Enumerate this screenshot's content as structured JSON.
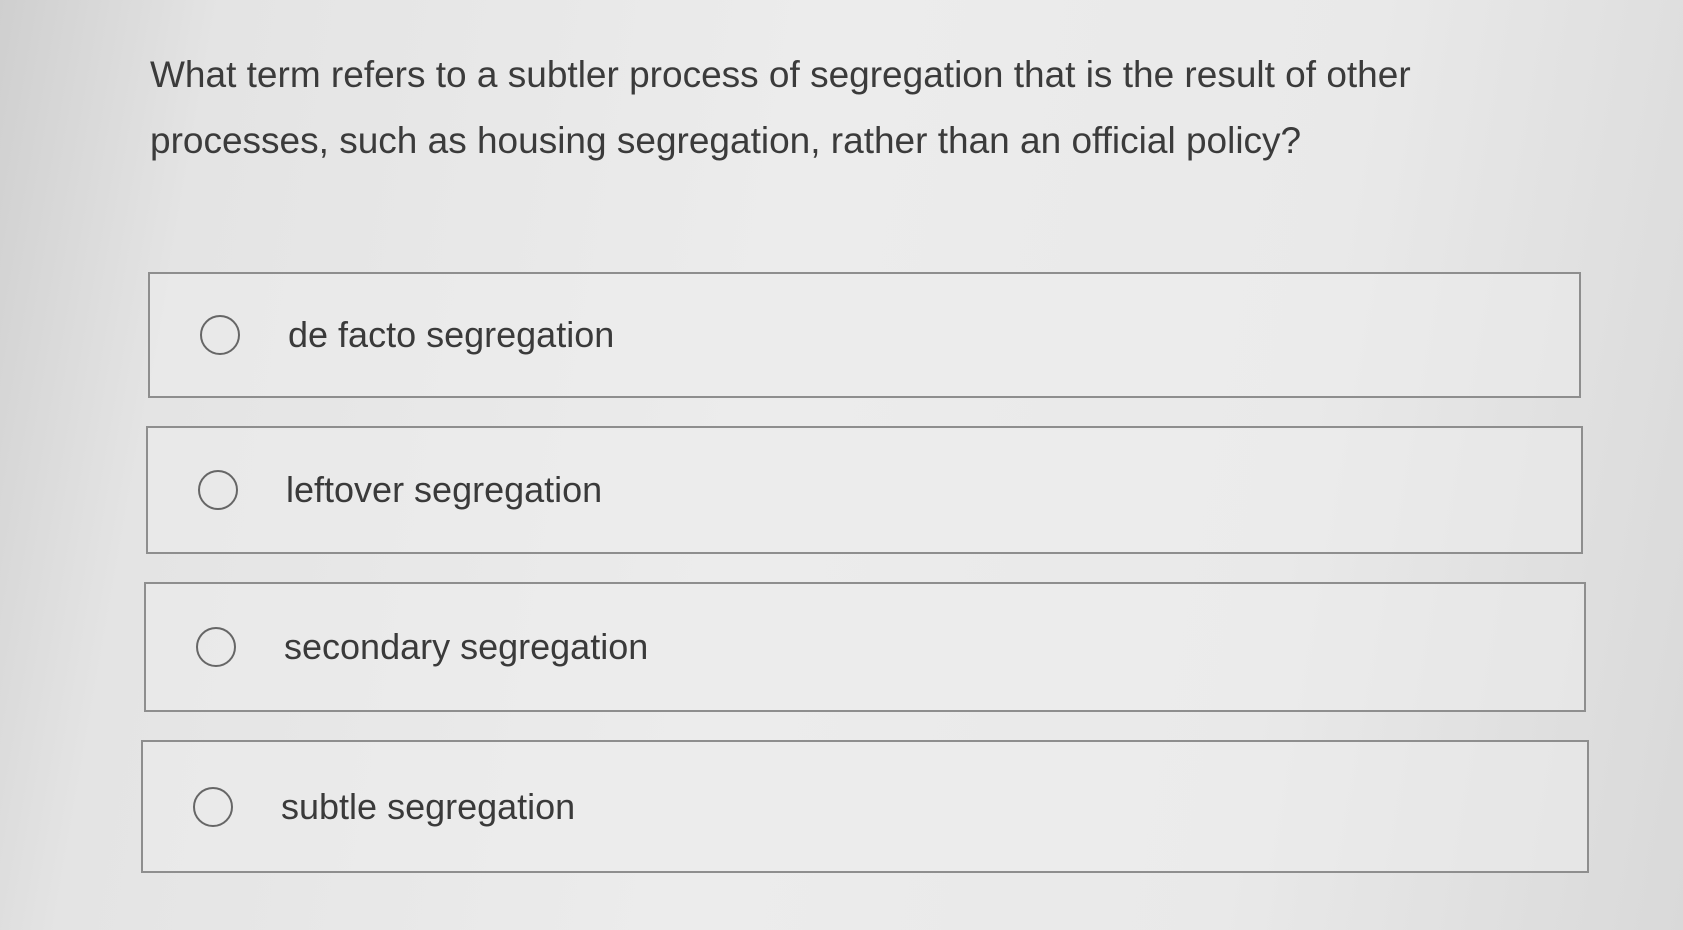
{
  "question": {
    "text": "What term refers to a subtler process of segregation that is the result of other processes, such as housing segregation, rather than an official policy?"
  },
  "options": [
    {
      "label": "de facto segregation",
      "icon": "radio-unselected-icon"
    },
    {
      "label": "leftover segregation",
      "icon": "radio-unselected-icon"
    },
    {
      "label": "secondary segregation",
      "icon": "radio-unselected-icon"
    },
    {
      "label": "subtle segregation",
      "icon": "radio-unselected-icon"
    }
  ]
}
